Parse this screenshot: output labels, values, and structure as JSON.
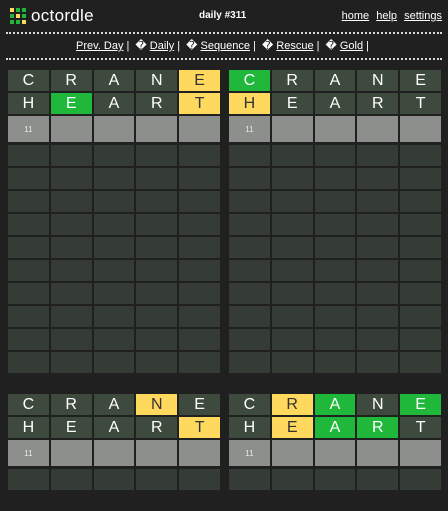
{
  "header": {
    "logo_text": "octordle",
    "logo_colors": [
      "#ffd95e",
      "#1fb83a",
      "#1fb83a",
      "#1fb83a",
      "#ffd95e",
      "#1fb83a",
      "#1fb83a",
      "#1fb83a",
      "#ffd95e"
    ],
    "daily_label": "daily #311",
    "links": [
      "home",
      "help",
      "settings"
    ]
  },
  "modes": {
    "prev_day": "Prev. Day",
    "items": [
      "Daily",
      "Sequence",
      "Rescue",
      "Gold"
    ],
    "icon_glyph": "�"
  },
  "next_row_label": "11",
  "boards": [
    {
      "rows": [
        {
          "letters": [
            "C",
            "R",
            "A",
            "N",
            "E"
          ],
          "states": [
            "g",
            "g",
            "g",
            "g",
            "y"
          ]
        },
        {
          "letters": [
            "H",
            "E",
            "A",
            "R",
            "T"
          ],
          "states": [
            "g",
            "G",
            "g",
            "g",
            "y"
          ]
        }
      ]
    },
    {
      "rows": [
        {
          "letters": [
            "C",
            "R",
            "A",
            "N",
            "E"
          ],
          "states": [
            "G",
            "g",
            "g",
            "g",
            "g"
          ]
        },
        {
          "letters": [
            "H",
            "E",
            "A",
            "R",
            "T"
          ],
          "states": [
            "y",
            "g",
            "g",
            "g",
            "g"
          ]
        }
      ]
    },
    {
      "rows": [
        {
          "letters": [
            "C",
            "R",
            "A",
            "N",
            "E"
          ],
          "states": [
            "g",
            "g",
            "g",
            "y",
            "g"
          ]
        },
        {
          "letters": [
            "H",
            "E",
            "A",
            "R",
            "T"
          ],
          "states": [
            "g",
            "g",
            "g",
            "g",
            "y"
          ]
        }
      ]
    },
    {
      "rows": [
        {
          "letters": [
            "C",
            "R",
            "A",
            "N",
            "E"
          ],
          "states": [
            "g",
            "y",
            "G",
            "g",
            "G"
          ]
        },
        {
          "letters": [
            "H",
            "E",
            "A",
            "R",
            "T"
          ],
          "states": [
            "g",
            "y",
            "G",
            "G",
            "g"
          ]
        }
      ]
    }
  ],
  "colors": {
    "green": "#1fb83a",
    "yellow": "#ffd95e",
    "gray": "#3f4a3f",
    "background": "#1f201f"
  }
}
